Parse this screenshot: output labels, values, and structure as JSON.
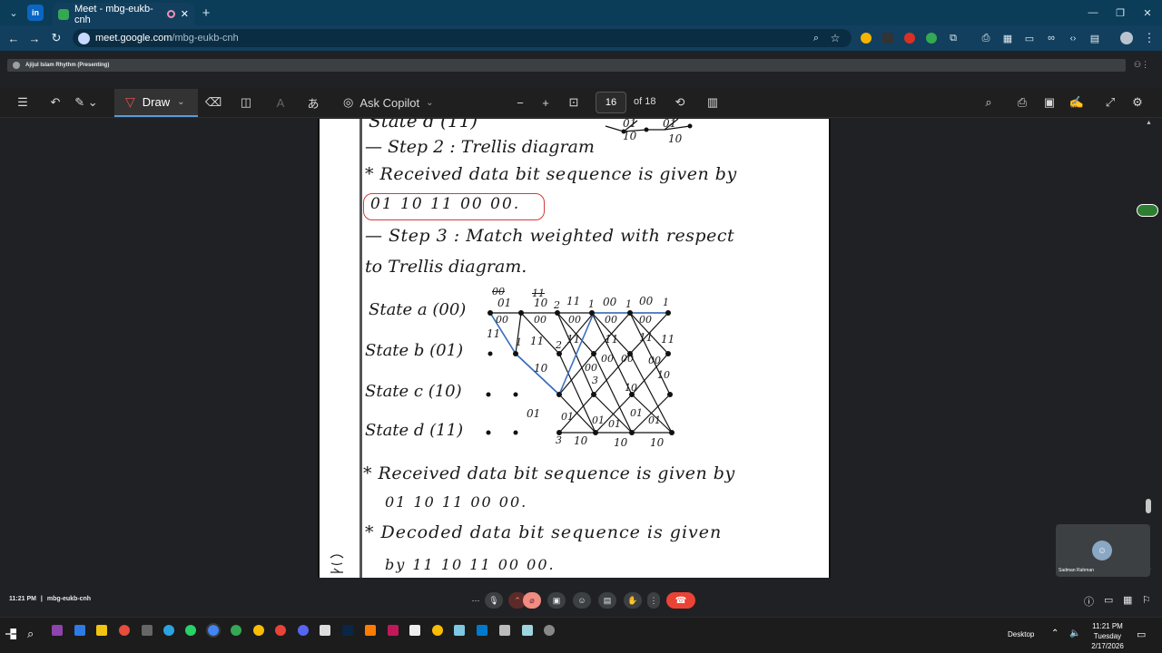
{
  "browser": {
    "tab_title": "Meet - mbg-eukb-cnh",
    "url_domain": "meet.google.com",
    "url_path": "/mbg-eukb-cnh",
    "new_tab": "+"
  },
  "presenting": {
    "label": "Ajijul Islam Rhythm (Presenting)"
  },
  "pdf_toolbar": {
    "draw_label": "Draw",
    "copilot_label": "Ask Copilot",
    "current_page": "16",
    "page_total": "of 18"
  },
  "notes": {
    "top_fragment": "State d (11)",
    "top_diagram_labels": [
      "01",
      "01",
      "10",
      "10"
    ],
    "step2": "— Step 2 : Trellis diagram",
    "received1": "* Received data bit sequence is given by",
    "boxed_sequence": "01 10 11 00 00.",
    "step3_line1": "— Step 3 : Match weighted with respect",
    "step3_line2": "to Trellis diagram.",
    "state_a": "State a (00)",
    "state_b": "State b (01)",
    "state_c": "State c (10)",
    "state_d": "State d (11)",
    "received2_line1": "* Received data bit sequence is given by",
    "received2_line2": "01 10 11 00 00.",
    "decoded_line1": "* Decoded data bit sequence is given",
    "decoded_line2": "by 11 10 11 00 00."
  },
  "trellis": {
    "top_labels": [
      "00",
      "11",
      "01",
      "10",
      "2",
      "11",
      "1",
      "00",
      "1",
      "00",
      "1"
    ],
    "a_row_labels": [
      "00",
      "00",
      "00",
      "00",
      "00"
    ],
    "mid_labels": [
      "11",
      "1",
      "11",
      "2",
      "11",
      "11",
      "11",
      "11",
      "3",
      "00",
      "10",
      "00",
      "00",
      "00",
      "10",
      "10"
    ],
    "bottom_labels": [
      "01",
      "01",
      "01",
      "01",
      "01",
      "01",
      "3",
      "10",
      "10",
      "10"
    ]
  },
  "meet": {
    "time": "11:21 PM",
    "separator": "|",
    "meeting_code": "mbg-eukb-cnh",
    "self_name": "Sadman Rahman"
  },
  "taskbar": {
    "desktop_label": "Desktop",
    "clock_time": "11:21 PM",
    "clock_day": "Tuesday",
    "clock_date": "2/17/2026"
  },
  "colors": {
    "tab_bg": "#0b3d59",
    "toolbar_bg": "#123f5e",
    "end_call": "#ea4335",
    "ink_red": "#d43a3a",
    "ink_blue": "#3b6fc0"
  }
}
